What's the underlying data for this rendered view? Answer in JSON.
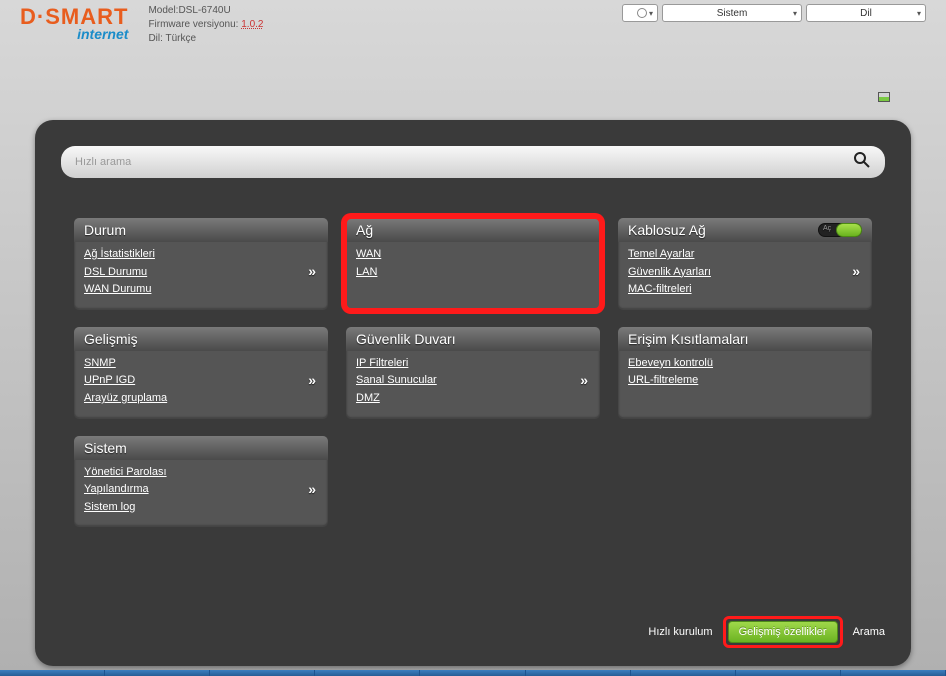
{
  "header": {
    "logo_main": "D·SMART",
    "logo_sub": "internet",
    "model_label": "Model:",
    "model_value": "DSL-6740U",
    "firmware_label": "Firmware versiyonu:",
    "firmware_value": "1.0.2",
    "lang_label": "Dil:",
    "lang_value": "Türkçe",
    "dropdowns": {
      "system": "Sistem",
      "language": "Dil"
    }
  },
  "search": {
    "placeholder": "Hızlı arama"
  },
  "cards": {
    "status": {
      "title": "Durum",
      "links": [
        "Ağ İstatistikleri",
        "DSL Durumu",
        "WAN Durumu"
      ]
    },
    "network": {
      "title": "Ağ",
      "links": [
        "WAN",
        "LAN"
      ]
    },
    "wireless": {
      "title": "Kablosuz Ağ",
      "toggle_label": "Aç",
      "links": [
        "Temel Ayarlar",
        "Güvenlik Ayarları",
        "MAC-filtreleri"
      ]
    },
    "advanced": {
      "title": "Gelişmiş",
      "links": [
        "SNMP",
        "UPnP IGD",
        "Arayüz gruplama"
      ]
    },
    "firewall": {
      "title": "Güvenlik Duvarı",
      "links": [
        "IP Filtreleri",
        "Sanal Sunucular",
        "DMZ"
      ]
    },
    "access": {
      "title": "Erişim Kısıtlamaları",
      "links": [
        "Ebeveyn kontrolü",
        "URL-filtreleme"
      ]
    },
    "system": {
      "title": "Sistem",
      "links": [
        "Yönetici Parolası",
        "Yapılandırma",
        "Sistem log"
      ]
    }
  },
  "footer": {
    "quick_setup": "Hızlı kurulum",
    "advanced_features": "Gelişmiş özellikler",
    "search": "Arama"
  }
}
